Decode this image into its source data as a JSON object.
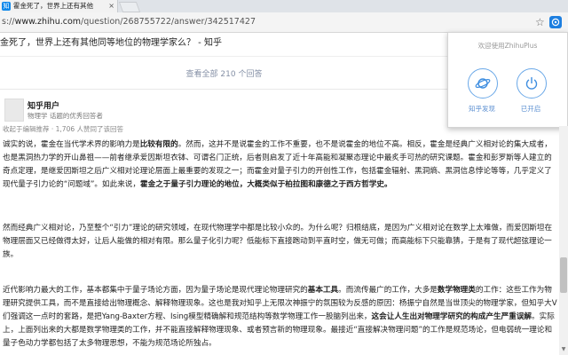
{
  "browser": {
    "tab_favicon": "知",
    "tab_title": "霍金死了，世界上还有其他",
    "tab_close": "×",
    "url_prefix": "s://",
    "url_host": "www.zhihu.com",
    "url_path": "/question/268755722/answer/342517427",
    "star_icon": "☆",
    "extension_icon": "zhihuplus-icon"
  },
  "page": {
    "title": "金死了，世界上还有其他同等地位的物理学家么？ - 知乎",
    "view_all": "查看全部 210 个回答"
  },
  "answer": {
    "author": "知乎用户",
    "badge": "物理学 话题的优秀回答者",
    "votes": "收起于编辑推荐 · 1,706 人赞同了该回答",
    "p1_a": "诚实的说，霍金在当代学术界的影响力是",
    "p1_b": "比较有限的",
    "p1_c": "。然而，这并不是说霍金的工作不重要，也不是说霍金的地位不高。相反，霍金是经典广义相对论的集大成者，也是黑洞热力学的开山鼻祖——前者继承爱因斯坦衣钵、可谓名门正统，后者则启发了近十年高能和凝聚态理论中最炙手可热的研究课题。霍金和彭罗斯等人建立的奇点定理，是继爱因斯坦之后广义相对论理论层面上最重要的发现之一；而霍金对量子引力的开创性工作，包括霍金辐射、黑洞熵、黑洞信息悖论等等，几乎定义了现代量子引力论的“问题域”。如此来说，",
    "p1_d": "霍金之于量子引力理论的地位，大概类似于柏拉图和康德之于西方哲学史。",
    "p2": "然而经典广义相对论，乃至整个“引力”理论的研究领域，在现代物理学中都是比较小众的。为什么呢？归根结底，是因为广义相对论在数学上太难做，而爱因斯坦在物理层面又已经做得太好，让后人能做的相对有限。那么量子化引力呢？低能标下直接跑动到平直时空，做无可做；而高能标下只能靠猜，于是有了现代超弦理论一族。",
    "p3_a": "近代影响力最大的工作，基本都集中于量子场论方面，因为量子场论是现代理论物理研究的",
    "p3_b": "基本工具",
    "p3_c": "。而流传最广的工作，大多是",
    "p3_d": "数学物理类",
    "p3_e": "的工作：这些工作为物理研究提供工具，而不是直接给出物理概念、解释物理现象。这也是我对知乎上无限次神振宁的氛围较为反感的原因：杨振宁自然是当世顶尖的物理学家，但知乎大V们强调这一点时的套路，是把Yang-Baxter方程、Ising模型精确解和规范结构等数学物理工作一股脑列出来，",
    "p3_f": "这会让人生出对物理学研究的构成产生严重误解",
    "p3_g": "。实际上，上面列出来的大都是数学物理类的工作，并不能直接解释物理现象、或者预言新的物理现象。最接近“直接解决物理问题”的工作是规范场论，但电弱统一理论和量子色动力学都包括了太多物理思想，不能为规范场论所独占。"
  },
  "popup": {
    "title": "欢迎使用ZhihuPlus",
    "discover_label": "知乎发现",
    "enabled_label": "已开启",
    "discover_icon": "planet-icon",
    "enabled_icon": "power-icon"
  }
}
